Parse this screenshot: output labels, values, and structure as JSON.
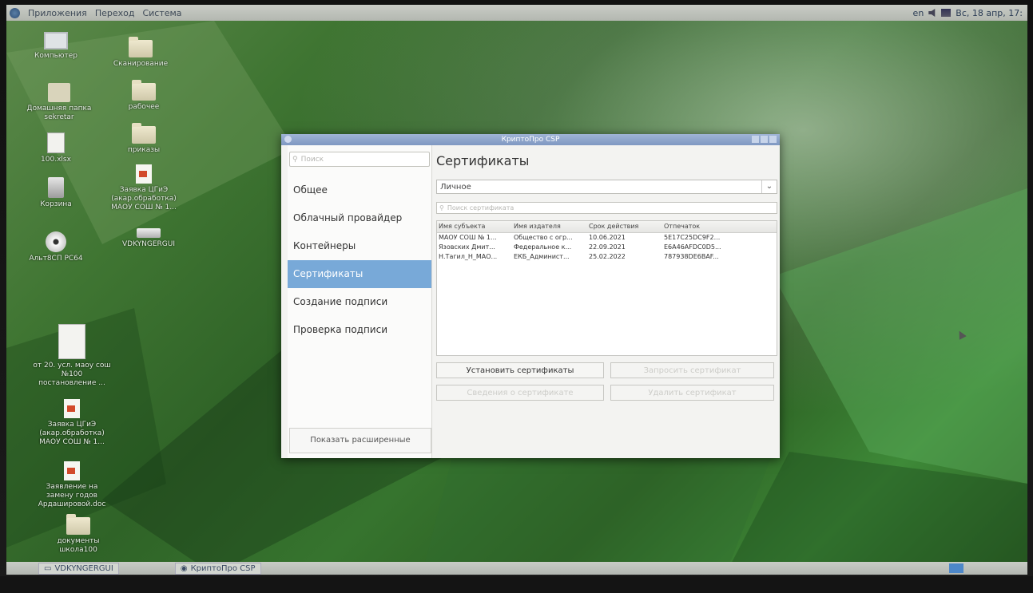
{
  "top_panel": {
    "menu": [
      "Приложения",
      "Переход",
      "Система"
    ],
    "keyboard_layout": "en",
    "clock": "Вс, 18 апр, 17:"
  },
  "desktop_icons": [
    {
      "label": "Компьютер",
      "icon": "computer-icon"
    },
    {
      "label": "Сканирование",
      "icon": "folder-icon"
    },
    {
      "label": "Домашняя папка sekretar",
      "icon": "home-folder-icon"
    },
    {
      "label": "рабочее",
      "icon": "folder-icon"
    },
    {
      "label": "100.xlsx",
      "icon": "spreadsheet-icon"
    },
    {
      "label": "приказы",
      "icon": "folder-icon"
    },
    {
      "label": "Корзина",
      "icon": "trash-icon"
    },
    {
      "label": "Заявка ЦГиЭ (акар.обработка) МАОУ СОШ № 1...",
      "icon": "document-icon"
    },
    {
      "label": "Альт8СП РС64",
      "icon": "disc-icon"
    },
    {
      "label": "VDKYNGERGUI",
      "icon": "drive-icon"
    },
    {
      "label": "от 20. усл. маоу сош №100 постановление ...",
      "icon": "document-icon"
    },
    {
      "label": "Заявка ЦГиЭ (акар.обработка) МАОУ СОШ № 1...",
      "icon": "document-icon"
    },
    {
      "label": "Заявление на замену годов Ардашировой.doc",
      "icon": "document-icon"
    },
    {
      "label": "документы школа100",
      "icon": "folder-icon"
    }
  ],
  "window": {
    "title": "КриптоПро CSP",
    "sidebar": {
      "search_placeholder": "Поиск",
      "items": [
        "Общее",
        "Облачный провайдер",
        "Контейнеры",
        "Сертификаты",
        "Создание подписи",
        "Проверка подписи"
      ],
      "active_item": "Сертификаты",
      "show_advanced": "Показать расширенные"
    },
    "content": {
      "title": "Сертификаты",
      "store": "Личное",
      "search_placeholder": "Поиск сертификата",
      "columns": [
        "Имя субъекта",
        "Имя издателя",
        "Срок действия",
        "Отпечаток"
      ],
      "rows": [
        [
          "МАОУ СОШ № 1...",
          "Общество с огр...",
          "10.06.2021",
          "5E17C25DC9F2..."
        ],
        [
          "Язовских Дмит...",
          "Федеральное к...",
          "22.09.2021",
          "E6A46AFDC0D5..."
        ],
        [
          "Н.Тагил_Н_МАО...",
          "ЕКБ_Админист...",
          "25.02.2022",
          "787938DE6BAF..."
        ]
      ],
      "buttons": {
        "install": "Установить сертификаты",
        "request": "Запросить сертификат",
        "view": "Сведения о сертификате",
        "delete": "Удалить сертификат"
      }
    }
  },
  "taskbar": {
    "tasks": [
      "VDKYNGERGUI",
      "КриптоПро CSP"
    ]
  }
}
